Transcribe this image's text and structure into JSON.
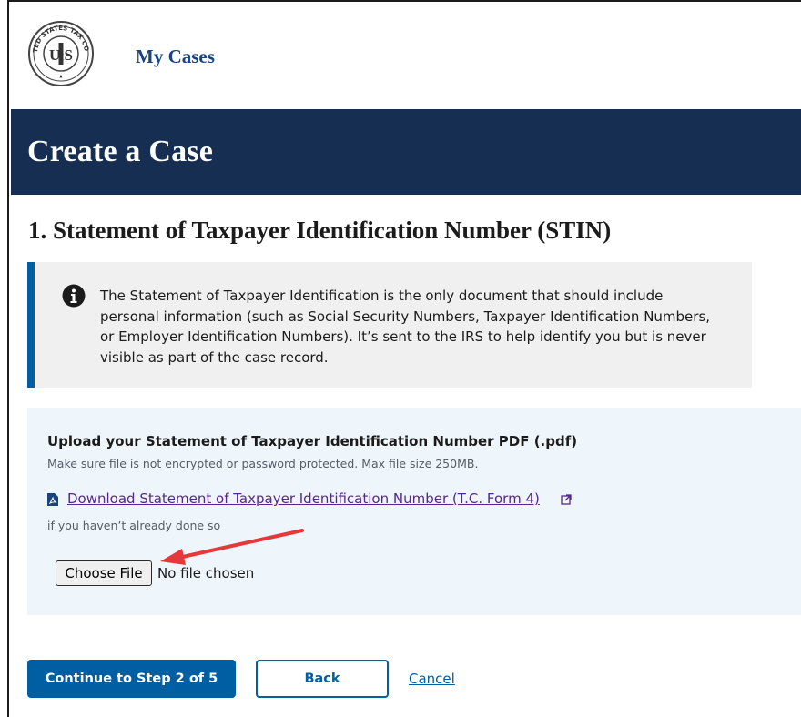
{
  "header": {
    "seal_text": "UNITED STATES TAX COURT",
    "seal_monogram": "USTC",
    "nav_link": "My Cases"
  },
  "banner": {
    "title": "Create a Case"
  },
  "step": {
    "title": "1. Statement of Taxpayer Identification Number (STIN)"
  },
  "alert": {
    "icon": "info-icon",
    "text": "The Statement of Taxpayer Identification is the only document that should include personal information (such as Social Security Numbers, Taxpayer Identification Numbers, or Employer Identification Numbers). It’s sent to the IRS to help identify you but is never visible as part of the case record."
  },
  "upload": {
    "title": "Upload your Statement of Taxpayer Identification Number PDF (.pdf)",
    "hint": "Make sure file is not encrypted or password protected. Max file size 250MB.",
    "download_link": "Download Statement of Taxpayer Identification Number (T.C. Form 4)",
    "download_note": "if you haven’t already done so",
    "choose_file_label": "Choose File",
    "file_status": "No file chosen"
  },
  "actions": {
    "continue_label": "Continue to Step 2 of 5",
    "back_label": "Back",
    "cancel_label": "Cancel"
  },
  "colors": {
    "banner_bg": "#162e51",
    "primary": "#005ea2",
    "link_visited": "#54278f",
    "alert_border": "#005ea2",
    "panel_bg": "#eff6fb",
    "annotation_arrow": "#e5383b"
  }
}
